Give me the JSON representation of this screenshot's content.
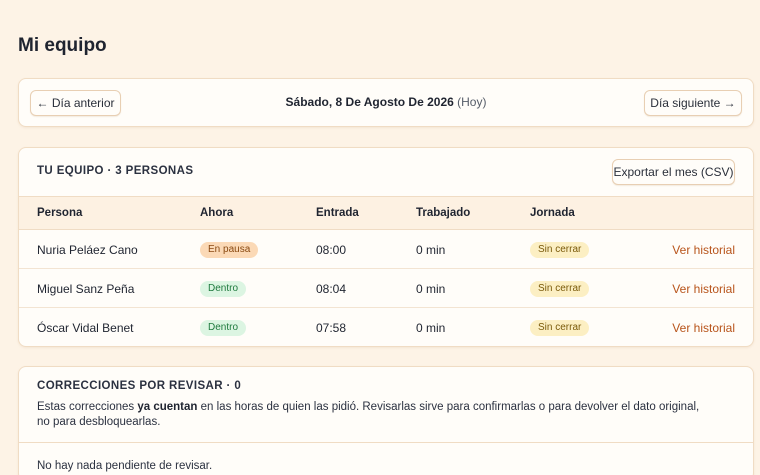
{
  "page": {
    "title": "Mi equipo"
  },
  "day_nav": {
    "prev_label": "← Día anterior",
    "next_label": "Día siguiente →",
    "date": "Sábado, 8 De Agosto De 2026",
    "today_suffix": "(Hoy)"
  },
  "team": {
    "heading": "TU EQUIPO · 3 PERSONAS",
    "export_label": "Exportar el mes (CSV)",
    "columns": [
      "Persona",
      "Ahora",
      "Entrada",
      "Trabajado",
      "Jornada"
    ],
    "rows": [
      {
        "persona": "Nuria Peláez Cano",
        "ahora": "En pausa",
        "ahora_status": "pause",
        "entrada": "08:00",
        "trabajado": "0 min",
        "jornada": "Sin cerrar",
        "link": "Ver historial"
      },
      {
        "persona": "Miguel Sanz Peña",
        "ahora": "Dentro",
        "ahora_status": "in",
        "entrada": "08:04",
        "trabajado": "0 min",
        "jornada": "Sin cerrar",
        "link": "Ver historial"
      },
      {
        "persona": "Óscar Vidal Benet",
        "ahora": "Dentro",
        "ahora_status": "in",
        "entrada": "07:58",
        "trabajado": "0 min",
        "jornada": "Sin cerrar",
        "link": "Ver historial"
      }
    ]
  },
  "corrections": {
    "heading": "CORRECCIONES POR REVISAR · 0",
    "text_before": "Estas correcciones ",
    "text_bold": "ya cuentan",
    "text_after": " en las horas de quien las pidió. Revisarlas sirve para confirmarlas o para devolver el dato original, no para desbloquearlas.",
    "empty": "No hay nada pendiente de revisar."
  },
  "colors": {
    "background": "#fdf3e6",
    "link": "#b8541b",
    "badge_pause": "#fbd9b6",
    "badge_in": "#dcf5e2",
    "badge_open": "#fcefc3"
  }
}
